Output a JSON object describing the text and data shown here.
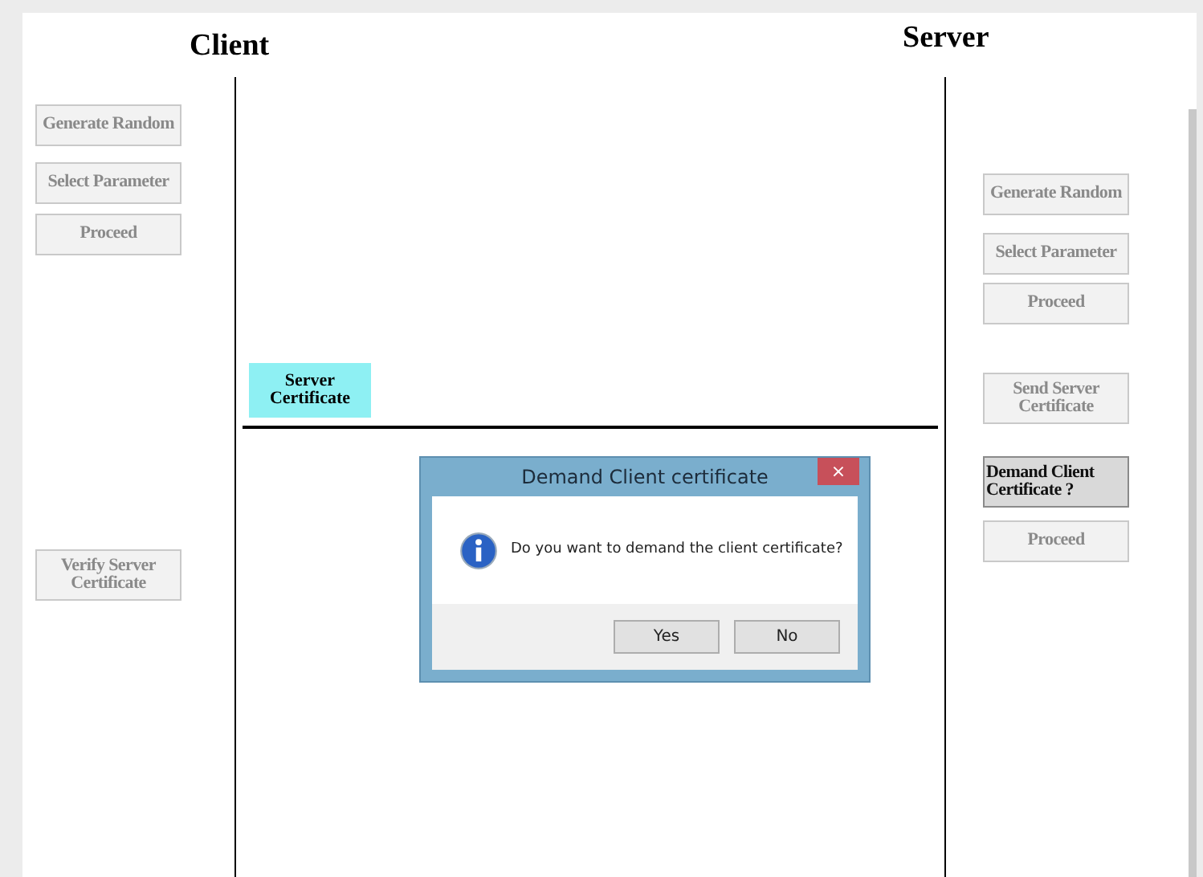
{
  "client": {
    "title": "Client",
    "buttons": [
      {
        "label": "Generate Random",
        "disabled": true
      },
      {
        "label": "Select Parameter",
        "disabled": true
      },
      {
        "label": "Proceed",
        "disabled": true
      },
      {
        "label": "Verify Server Certificate",
        "disabled": true
      }
    ]
  },
  "server": {
    "title": "Server",
    "buttons": [
      {
        "label": "Generate Random",
        "disabled": true
      },
      {
        "label": "Select Parameter",
        "disabled": true
      },
      {
        "label": "Proceed",
        "disabled": true
      },
      {
        "label": "Send Server Certificate",
        "disabled": true
      },
      {
        "label": "Demand Client Certificate ?",
        "disabled": false
      },
      {
        "label": "Proceed",
        "disabled": true
      }
    ]
  },
  "messages": [
    {
      "label": "Server Certificate"
    }
  ],
  "dialog": {
    "title": "Demand Client certificate",
    "close": "×",
    "message": "Do you want to demand the client certificate?",
    "buttons": [
      "Yes",
      "No"
    ]
  }
}
